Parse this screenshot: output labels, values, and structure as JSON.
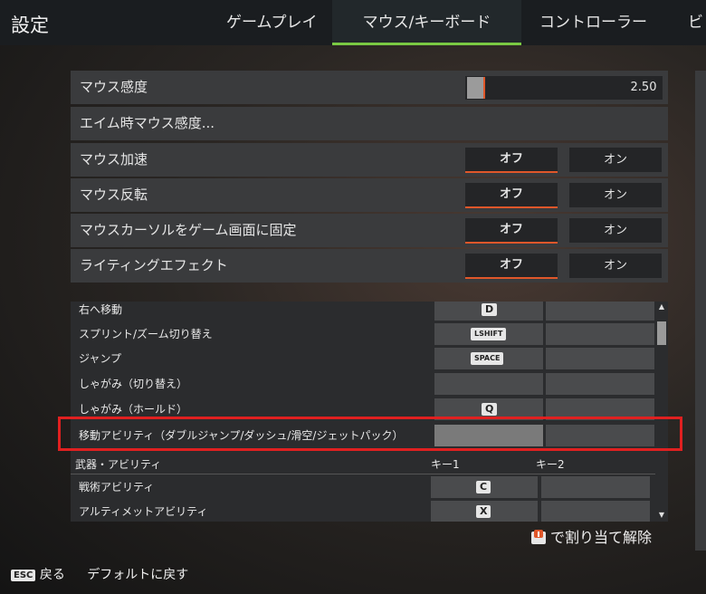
{
  "header": {
    "title": "設定",
    "tabs": [
      {
        "label": "ゲームプレイ",
        "active": false
      },
      {
        "label": "マウス/キーボード",
        "active": true
      },
      {
        "label": "コントローラー",
        "active": false
      },
      {
        "label": "ビ",
        "active": false
      }
    ]
  },
  "mouse_settings": {
    "sensitivity": {
      "label": "マウス感度",
      "value": "2.50",
      "fill_fraction": 0.06
    },
    "ads_sensitivity": {
      "label": "エイム時マウス感度..."
    },
    "toggles": [
      {
        "label": "マウス加速",
        "off": "オフ",
        "on": "オン",
        "selected": "off"
      },
      {
        "label": "マウス反転",
        "off": "オフ",
        "on": "オン",
        "selected": "off"
      },
      {
        "label": "マウスカーソルをゲーム画面に固定",
        "off": "オフ",
        "on": "オン",
        "selected": "off"
      },
      {
        "label": "ライティングエフェクト",
        "off": "オフ",
        "on": "オン",
        "selected": "off"
      }
    ]
  },
  "keybinds": {
    "rows": [
      {
        "label": "右へ移動",
        "key1": "D",
        "key2": ""
      },
      {
        "label": "スプリント/ズーム切り替え",
        "key1": "LSHIFT",
        "key2": ""
      },
      {
        "label": "ジャンプ",
        "key1": "SPACE",
        "key2": ""
      },
      {
        "label": "しゃがみ（切り替え）",
        "key1": "",
        "key2": ""
      },
      {
        "label": "しゃがみ（ホールド）",
        "key1": "Q",
        "key2": ""
      },
      {
        "label": "移動アビリティ（ダブルジャンプ/ダッシュ/滑空/ジェットパック）",
        "key1": "",
        "key2": ""
      }
    ],
    "section_header": {
      "label": "武器・アビリティ",
      "key1": "キー1",
      "key2": "キー2"
    },
    "section_rows": [
      {
        "label": "戦術アビリティ",
        "key1": "C",
        "key2": ""
      },
      {
        "label": "アルティメットアビリティ",
        "key1": "X",
        "key2": ""
      }
    ]
  },
  "unbind_hint": "で割り当て解除",
  "footer": {
    "esc_key": "ESC",
    "back": "戻る",
    "reset": "デフォルトに戻す"
  },
  "colors": {
    "accent_orange": "#e0572a",
    "tab_active_green": "#7ac943",
    "highlight_red": "#e02020"
  }
}
